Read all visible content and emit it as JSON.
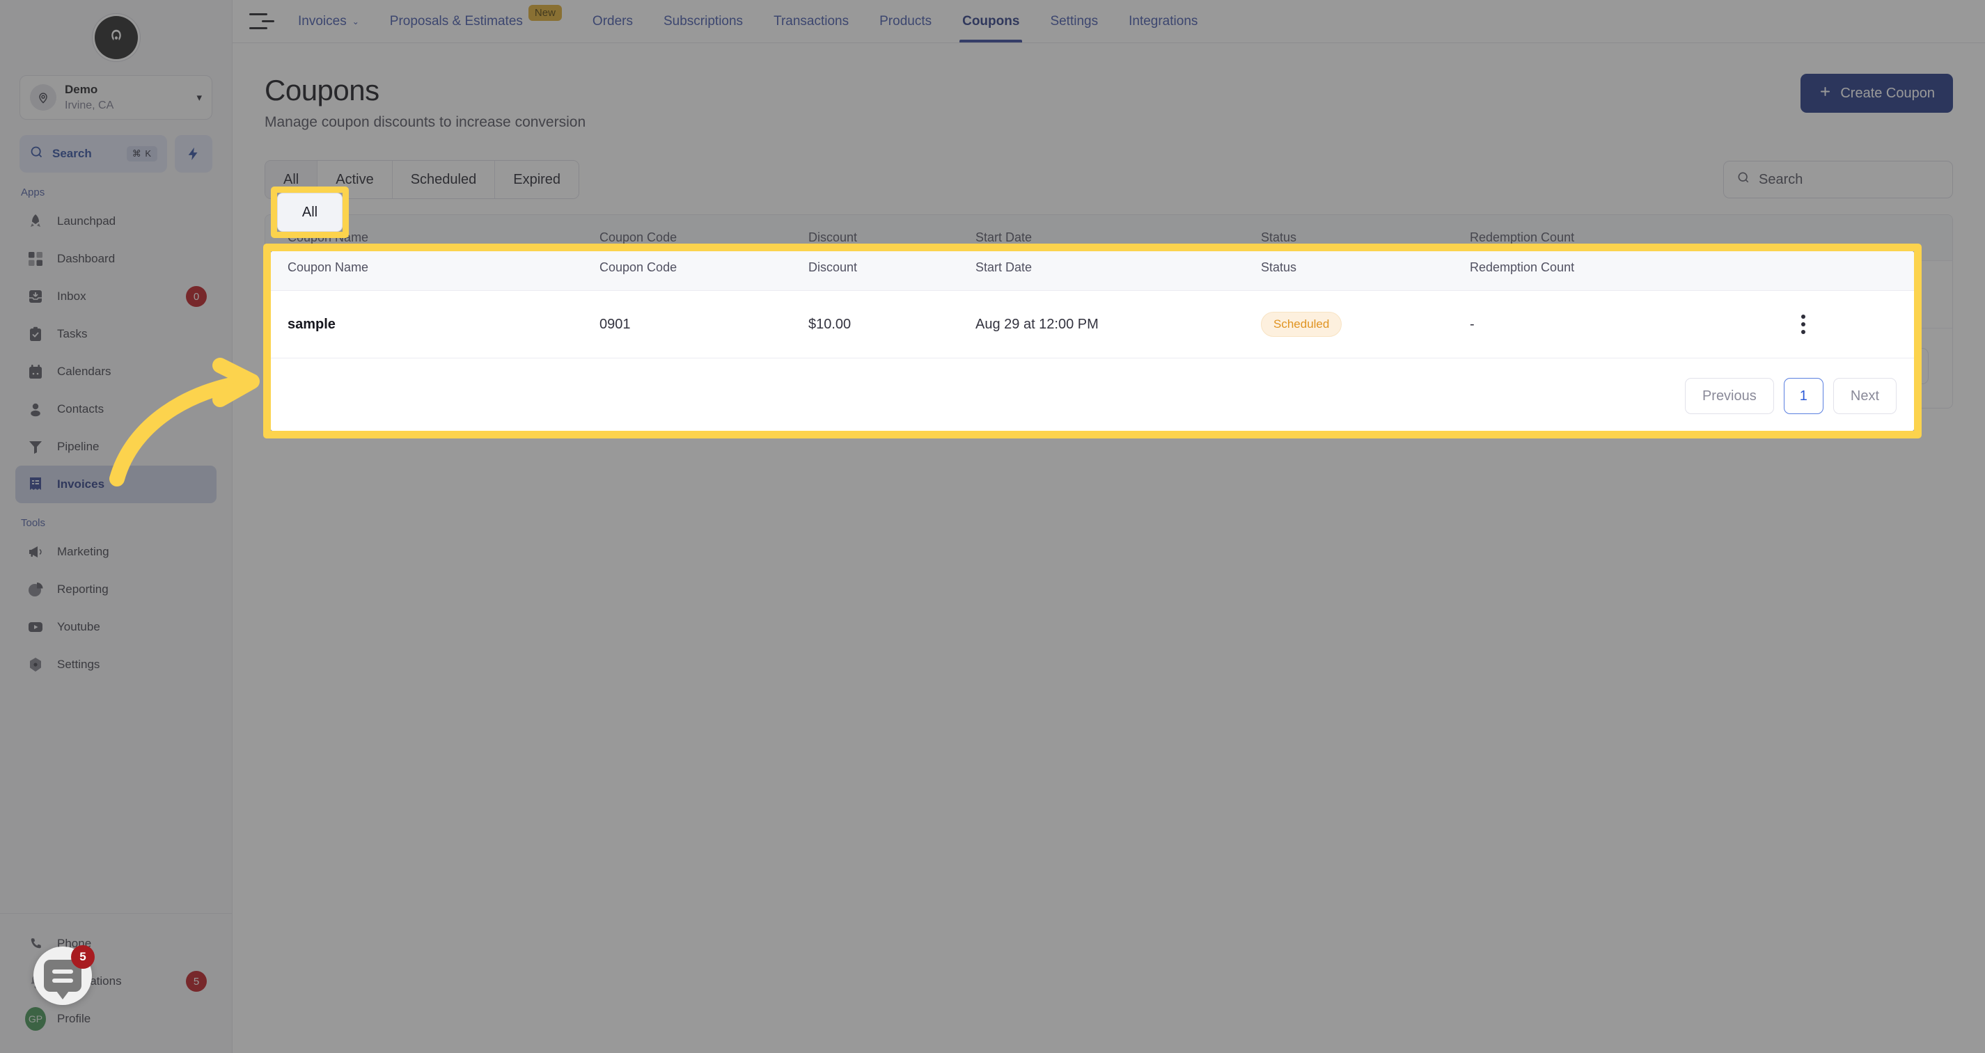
{
  "sidebar": {
    "brand_logo": "logo-a-icon",
    "location": {
      "name": "Demo",
      "sublabel": "Irvine, CA"
    },
    "search": {
      "label": "Search",
      "shortcut": "⌘ K"
    },
    "quick_action_icon": "lightning-bolt-icon",
    "sections": [
      {
        "label": "Apps",
        "items": [
          {
            "label": "Launchpad",
            "icon": "rocket-icon",
            "badge": ""
          },
          {
            "label": "Dashboard",
            "icon": "grid-icon",
            "badge": ""
          },
          {
            "label": "Inbox",
            "icon": "inbox-icon",
            "badge": "0"
          },
          {
            "label": "Tasks",
            "icon": "clipboard-check-icon",
            "badge": ""
          },
          {
            "label": "Calendars",
            "icon": "calendar-icon",
            "badge": ""
          },
          {
            "label": "Contacts",
            "icon": "user-icon",
            "badge": ""
          },
          {
            "label": "Pipeline",
            "icon": "funnel-icon",
            "badge": ""
          },
          {
            "label": "Invoices",
            "icon": "invoice-icon",
            "badge": "",
            "active": true
          }
        ]
      },
      {
        "label": "Tools",
        "items": [
          {
            "label": "Marketing",
            "icon": "megaphone-icon",
            "badge": ""
          },
          {
            "label": "Reporting",
            "icon": "pie-chart-icon",
            "badge": ""
          },
          {
            "label": "Youtube",
            "icon": "youtube-icon",
            "badge": ""
          },
          {
            "label": "Settings",
            "icon": "gear-icon",
            "badge": ""
          }
        ]
      }
    ],
    "bottom_items": [
      {
        "label": "Phone",
        "icon": "phone-icon",
        "badge": ""
      },
      {
        "label": "Notifications",
        "icon": "bell-icon",
        "badge": "5"
      },
      {
        "label": "Profile",
        "icon": "avatar-icon",
        "badge": "",
        "avatar_initials": "GP"
      }
    ]
  },
  "topbar": {
    "menu_icon": "hamburger-icon",
    "tabs": [
      {
        "label": "Invoices",
        "caret": "⌄",
        "pill": "",
        "current": false
      },
      {
        "label": "Proposals & Estimates",
        "caret": "",
        "pill": "New",
        "current": false
      },
      {
        "label": "Orders",
        "caret": "",
        "pill": "",
        "current": false
      },
      {
        "label": "Subscriptions",
        "caret": "",
        "pill": "",
        "current": false
      },
      {
        "label": "Transactions",
        "caret": "",
        "pill": "",
        "current": false
      },
      {
        "label": "Products",
        "caret": "",
        "pill": "",
        "current": false
      },
      {
        "label": "Coupons",
        "caret": "",
        "pill": "",
        "current": true
      },
      {
        "label": "Settings",
        "caret": "",
        "pill": "",
        "current": false
      },
      {
        "label": "Integrations",
        "caret": "",
        "pill": "",
        "current": false
      }
    ]
  },
  "page": {
    "title": "Coupons",
    "subtitle": "Manage coupon discounts to increase conversion",
    "create_button": {
      "label": "Create Coupon",
      "icon": "plus-icon"
    }
  },
  "filters": {
    "tabs": [
      {
        "label": "All",
        "selected": true
      },
      {
        "label": "Active",
        "selected": false
      },
      {
        "label": "Scheduled",
        "selected": false
      },
      {
        "label": "Expired",
        "selected": false
      }
    ],
    "search": {
      "placeholder": "Search",
      "value": "",
      "icon": "search-icon"
    }
  },
  "table": {
    "columns": [
      "Coupon Name",
      "Coupon Code",
      "Discount",
      "Start Date",
      "Status",
      "Redemption Count"
    ],
    "rows": [
      {
        "coupon_name": "sample",
        "coupon_code": "0901",
        "discount": "$10.00",
        "start_date": "Aug 29 at 12:00 PM",
        "status": "Scheduled",
        "redemption_count": "-",
        "menu_icon": "kebab-menu-icon"
      }
    ]
  },
  "pagination": {
    "previous": "Previous",
    "pages": [
      "1"
    ],
    "next": "Next",
    "current_page": "1"
  },
  "annotations": {
    "highlight_color": "#fcd34d",
    "arrow": "curved-arrow-pointing-right"
  },
  "chat_widget": {
    "icon": "chat-bubble-icon",
    "badge": "5"
  },
  "colors": {
    "accent": "#1c3180",
    "sidebar_active": "#c9cfe3",
    "status_scheduled_text": "#e09422",
    "status_scheduled_bg": "#fdf0de",
    "badge_red": "#b8131b",
    "highlight_yellow": "#fcd34d"
  }
}
